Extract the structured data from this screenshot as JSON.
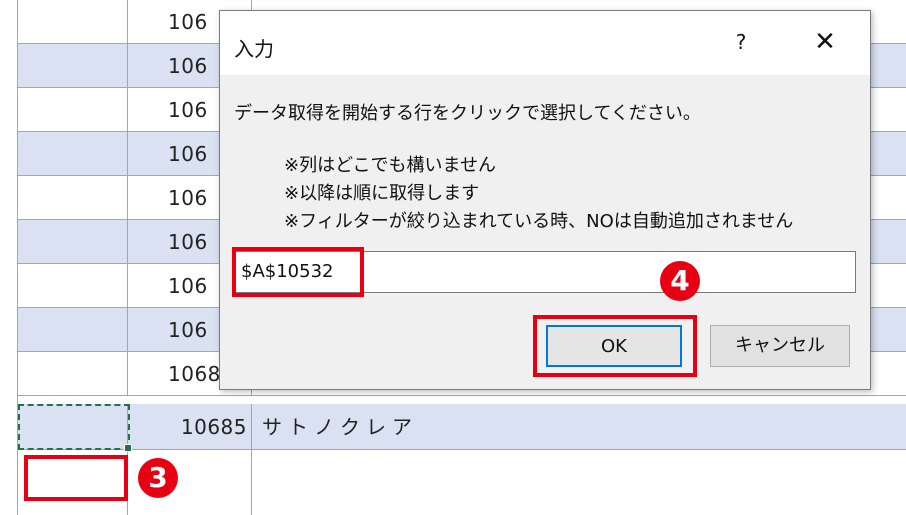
{
  "sheet": {
    "rows": [
      {
        "num": "106",
        "name": "",
        "style": "white"
      },
      {
        "num": "106",
        "name": "",
        "style": "blue"
      },
      {
        "num": "106",
        "name": "",
        "style": "white"
      },
      {
        "num": "106",
        "name": "",
        "style": "blue"
      },
      {
        "num": "106",
        "name": "",
        "style": "white"
      },
      {
        "num": "106",
        "name": "",
        "style": "blue"
      },
      {
        "num": "106",
        "name": "",
        "style": "white"
      },
      {
        "num": "106",
        "name": "",
        "style": "blue"
      },
      {
        "num": "1068",
        "name": "",
        "style": "white"
      },
      {
        "num": "10685",
        "name": "サトノクレア",
        "style": "blue"
      }
    ]
  },
  "dialog": {
    "title": "入力",
    "help_glyph": "?",
    "close_glyph": "✕",
    "prompt": "データ取得を開始する行をクリックで選択してください。",
    "notes": [
      "※列はどこでも構いません",
      "※以降は順に取得します",
      "※フィルターが絞り込まれている時、NOは自動追加されません"
    ],
    "input_value": "$A$10532",
    "ok_label": "OK",
    "cancel_label": "キャンセル"
  },
  "annotations": {
    "step3": "3",
    "step4": "4",
    "highlight_color": "#e60012"
  }
}
